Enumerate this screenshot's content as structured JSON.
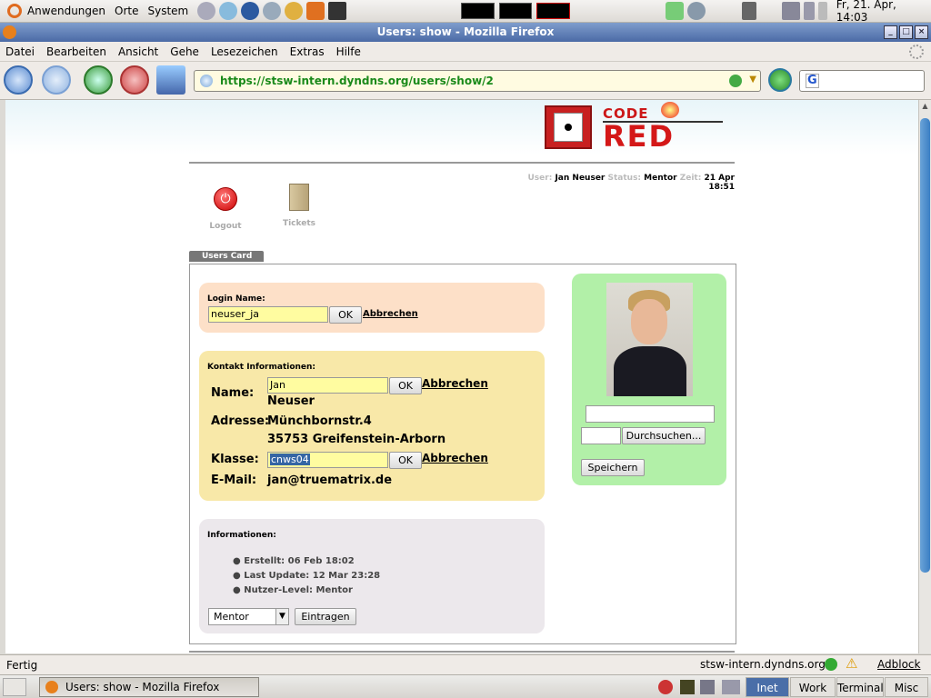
{
  "top_panel": {
    "menu_apps": "Anwendungen",
    "menu_places": "Orte",
    "menu_system": "System",
    "clock": "Fr, 21. Apr, 14:03"
  },
  "window": {
    "title": "Users: show - Mozilla Firefox"
  },
  "menubar": [
    "Datei",
    "Bearbeiten",
    "Ansicht",
    "Gehe",
    "Lesezeichen",
    "Extras",
    "Hilfe"
  ],
  "navbar": {
    "url": "https://stsw-intern.dyndns.org/users/show/2",
    "search_placeholder": ""
  },
  "header": {
    "logo_top": "CODE",
    "logo_bottom": "RED",
    "user_label": "User:",
    "user_value": "Jan Neuser",
    "status_label": "Status:",
    "status_value": "Mentor",
    "time_label": "Zeit:",
    "time_value": "21 Apr 18:51"
  },
  "toolbar": {
    "logout": "Logout",
    "tickets": "Tickets"
  },
  "card": {
    "tab_label": "Users Card",
    "login_section": {
      "title": "Login Name:",
      "value": "neuser_ja",
      "ok": "OK",
      "cancel": "Abbrechen"
    },
    "contact_section": {
      "title": "Kontakt Informationen:",
      "name_label": "Name:",
      "first_name": "Jan",
      "ok": "OK",
      "cancel": "Abbrechen",
      "last_name": "Neuser",
      "address_label": "Adresse:",
      "street": "Münchbornstr.4",
      "city": "35753 Greifenstein-Arborn",
      "class_label": "Klasse:",
      "class_value": "cnws04",
      "email_label": "E-Mail:",
      "email": "jan@truematrix.de"
    },
    "info_section": {
      "title": "Informationen:",
      "items": [
        "Erstellt: 06 Feb 18:02",
        "Last Update: 12 Mar 23:28",
        "Nutzer-Level: Mentor"
      ],
      "level_select": "Mentor",
      "submit": "Eintragen"
    },
    "photo_section": {
      "browse": "Durchsuchen...",
      "save": "Speichern"
    }
  },
  "statusbar": {
    "status": "Fertig",
    "host": "stsw-intern.dyndns.org",
    "adblock": "Adblock"
  },
  "bottom_panel": {
    "task": "Users: show - Mozilla Firefox",
    "workspaces": [
      "Inet",
      "Work",
      "Terminal",
      "Misc"
    ]
  },
  "colors": {
    "login_bg": "#fde0c8",
    "contact_bg": "#f8e8a8",
    "info_bg": "#ece8ec",
    "photo_bg": "#b2f0a8",
    "input_bg": "#fffca0"
  }
}
